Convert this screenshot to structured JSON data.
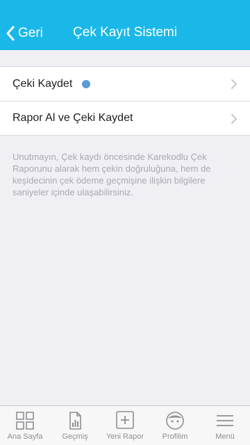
{
  "header": {
    "back_label": "Geri",
    "title": "Çek Kayıt Sistemi",
    "background": "#1ab8e8"
  },
  "menu": {
    "items": [
      {
        "label": "Çeki Kaydet",
        "has_dot": true,
        "dot_color": "#5b9bd6"
      },
      {
        "label": "Rapor Al ve Çeki Kaydet",
        "has_dot": false
      }
    ]
  },
  "note": "Unutmayın, Çek kaydı öncesinde Karekodlu Çek Raporunu alarak hem çekin doğruluğuna, hem de keşidecinin çek ödeme geçmişine ilişkin bilgilere saniyeler içinde ulaşabilirsiniz.",
  "tabbar": {
    "tabs": [
      {
        "label": "Ana Sayfa",
        "icon": "grid-icon"
      },
      {
        "label": "Geçmiş",
        "icon": "chart-document-icon"
      },
      {
        "label": "Yeni Rapor",
        "icon": "plus-box-icon"
      },
      {
        "label": "Profilim",
        "icon": "face-icon"
      },
      {
        "label": "Menü",
        "icon": "hamburger-icon"
      }
    ]
  }
}
